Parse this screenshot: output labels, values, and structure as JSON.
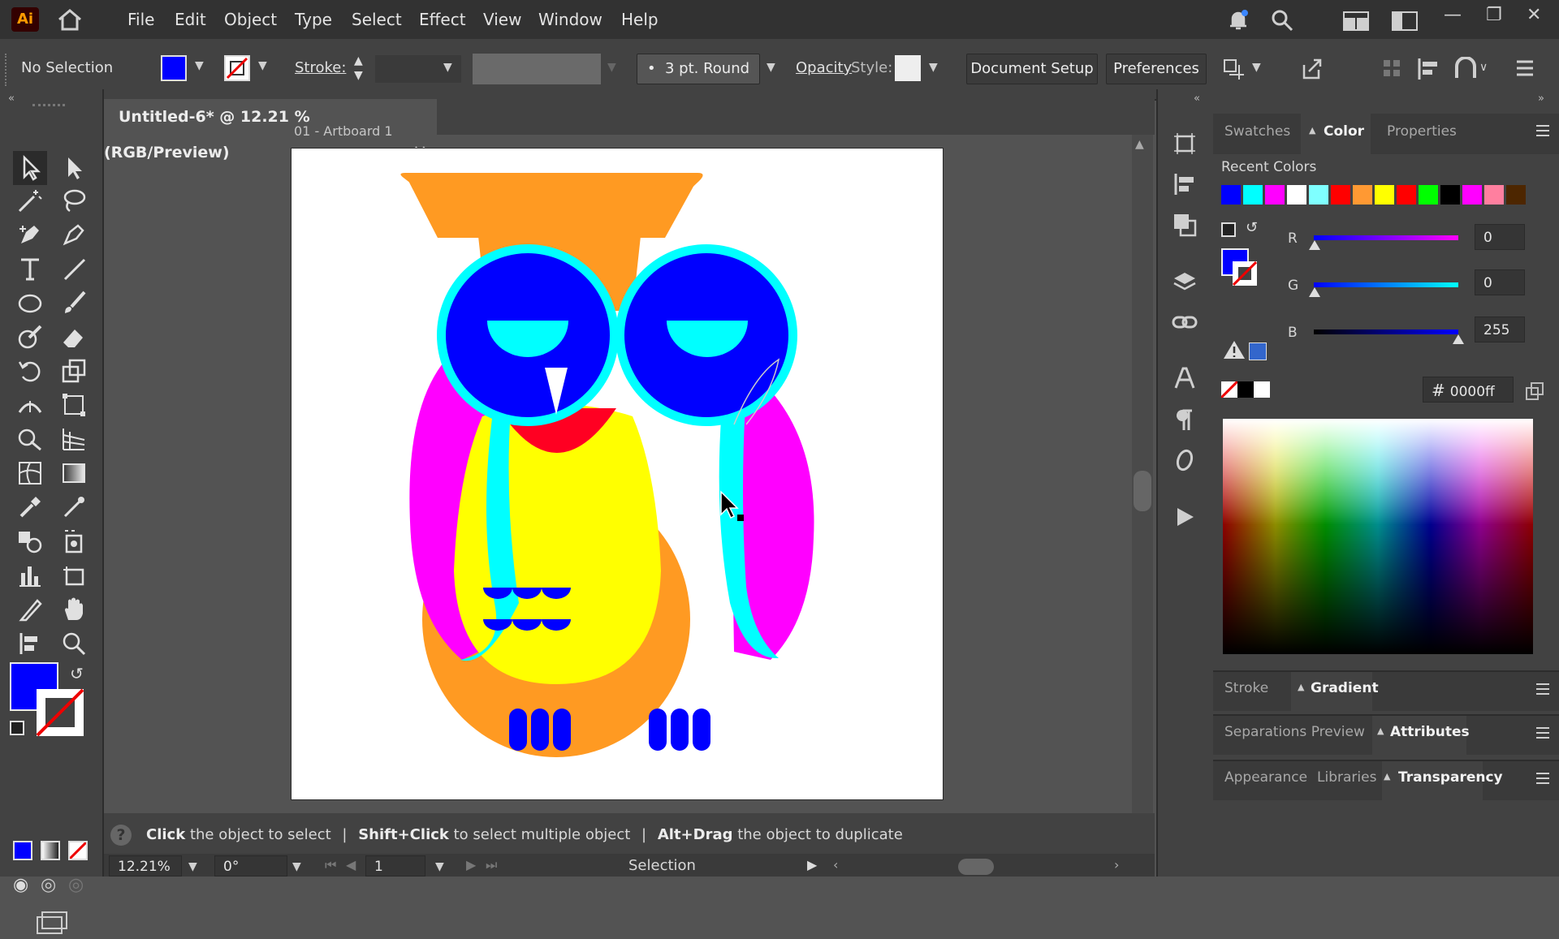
{
  "app": {
    "logo": "Ai"
  },
  "menu": [
    "File",
    "Edit",
    "Object",
    "Type",
    "Select",
    "Effect",
    "View",
    "Window",
    "Help"
  ],
  "control_bar": {
    "selection": "No Selection",
    "stroke_label": "Stroke:",
    "brush": "3 pt. Round",
    "opacity_label": "Opacity",
    "style_label": "Style:",
    "document_setup": "Document Setup",
    "preferences": "Preferences"
  },
  "document": {
    "tab_title": "Untitled-6* @ 12.21 % (RGB/Preview)",
    "close": "×",
    "artboard_label": "01 - Artboard 1"
  },
  "panels": {
    "top_tabs": [
      "Swatches",
      "Color",
      "Properties"
    ],
    "active_top_tab": "Color",
    "recent_colors_label": "Recent Colors",
    "recent_colors": [
      "#0000ff",
      "#00ffff",
      "#ff00ff",
      "#ffffff",
      "#7fffff",
      "#ff0000",
      "#ff9933",
      "#ffff00",
      "#ff0000",
      "#00ff00",
      "#000000",
      "#ff00ff",
      "#ff7f9f",
      "#4d2600"
    ],
    "color": {
      "r_label": "R",
      "g_label": "G",
      "b_label": "B",
      "r": "0",
      "g": "0",
      "b": "255",
      "hash": "#",
      "hex": "0000ff"
    },
    "stroke_group": [
      "Stroke",
      "Gradient"
    ],
    "sep_group": [
      "Separations Preview",
      "Attributes"
    ],
    "appearance_group": [
      "Appearance",
      "Libraries",
      "Transparency"
    ]
  },
  "status": {
    "hint_1": "Click",
    "hint_1b": "the object to select",
    "sep": "|",
    "hint_2": "Shift+Click",
    "hint_2b": "to select multiple object",
    "hint_3": "Alt+Drag",
    "hint_3b": "the object to duplicate",
    "zoom": "12.21%",
    "rotation": "0°",
    "artboard_num": "1",
    "tool_name": "Selection"
  },
  "colors": {
    "fill": "#0000ff",
    "owl_orange": "#ff9a22",
    "owl_cyan": "#00ffff",
    "owl_blue": "#0000ff",
    "owl_magenta": "#ff00ff",
    "owl_yellow": "#ffff00",
    "owl_red": "#ff0022"
  }
}
